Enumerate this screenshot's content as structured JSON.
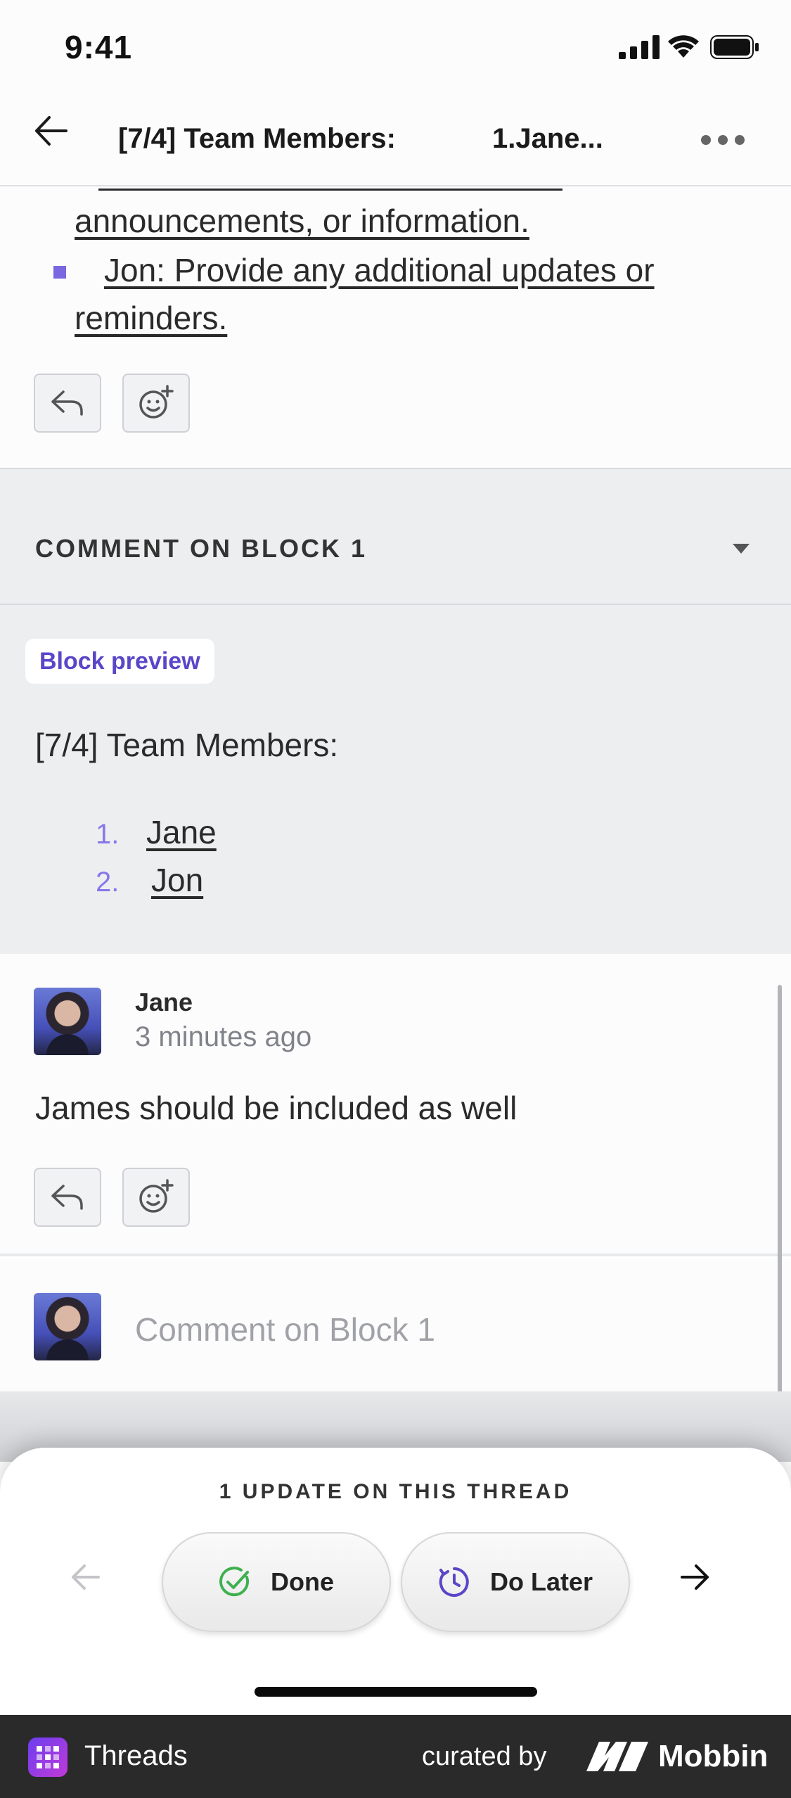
{
  "status_bar": {
    "time": "9:41"
  },
  "nav": {
    "title_part1": "[7/4] Team Members:",
    "title_part2": "1.Jane..."
  },
  "document": {
    "line1": "announcements, or information.",
    "line2": "Jon: Provide any additional updates or",
    "line3": "reminders."
  },
  "comment_header": {
    "label": "COMMENT ON BLOCK 1"
  },
  "preview": {
    "badge": "Block preview",
    "title": "[7/4] Team Members:",
    "items": [
      {
        "num": "1.",
        "name": "Jane"
      },
      {
        "num": "2.",
        "name": "Jon"
      }
    ]
  },
  "comment": {
    "author": "Jane",
    "time": "3 minutes ago",
    "text": "James should be included as well"
  },
  "composer": {
    "placeholder": "Comment on Block 1"
  },
  "sheet": {
    "title": "1 UPDATE ON THIS THREAD",
    "done_label": "Done",
    "later_label": "Do Later"
  },
  "footer": {
    "app_name": "Threads",
    "curated_by": "curated by",
    "brand": "Mobbin"
  },
  "colors": {
    "accent": "#7a68e0",
    "done_green": "#3fb04e",
    "later_purple": "#5a46c8"
  }
}
